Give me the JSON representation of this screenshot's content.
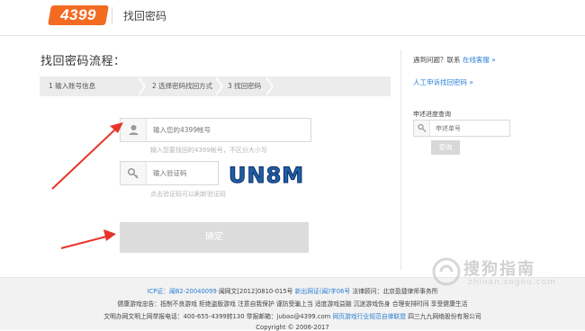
{
  "header": {
    "logo_text": "4399",
    "title": "找回密码",
    "brand_color": "#f26b21"
  },
  "main": {
    "title": "找回密码流程：",
    "steps": [
      {
        "label": "1 输入账号信息"
      },
      {
        "label": "2 选择密码找回方式"
      },
      {
        "label": "3 找回密码"
      }
    ],
    "account": {
      "placeholder": "输入您的4399帐号",
      "hint": "输入您要找回的4399帐号，不区分大小写",
      "icon": "user-icon"
    },
    "captcha": {
      "placeholder": "输入验证码",
      "hint": "点击验证码可以刷新验证码",
      "icon": "key-icon",
      "code": "UN8M"
    },
    "submit_label": "确定"
  },
  "sidebar": {
    "problem_text": "遇到问题？联系",
    "online_service": "在线客服 »",
    "manual_appeal": "人工申诉找回密码 »",
    "progress_title": "申述进度查询",
    "appeal_placeholder": "申述单号",
    "query_label": "查询"
  },
  "footer": {
    "line1": {
      "icp_label": "ICP证：",
      "icp_link": "闽B2-20040099",
      "culture": "闽网文[2012]0810-015号",
      "publish_link": "新出网证(闽)字06号",
      "legal": "法律顾问：北京盈捷律师事务所"
    },
    "line2": "健康游戏忠告：抵制不良游戏 拒绝盗版游戏 注意自我保护 谨防受骗上当 适度游戏益脑 沉迷游戏伤身 合理安排时间 享受健康生活",
    "line3": {
      "text": "文明办网文明上网举报电话：400-655-4399转130  举报邮箱：jubao@4399.com",
      "link": "网页游戏行业规范自律联盟",
      "company": "四三九九网络股份有限公司"
    },
    "copyright": "Copyright © 2006-2017"
  },
  "watermark": {
    "text": "搜狗指南",
    "sub": "zhinan.sogou.com"
  },
  "colors": {
    "link": "#2a7fd4",
    "arrow": "#e8332a",
    "button_disabled": "#dcdcdc"
  }
}
